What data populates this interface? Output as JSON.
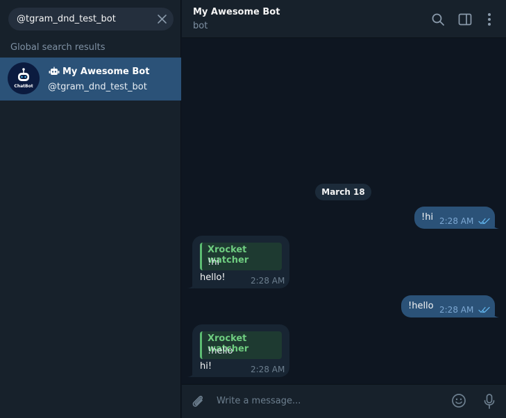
{
  "search": {
    "value": "@tgram_dnd_test_bot"
  },
  "sidebar": {
    "section_label": "Global search results",
    "results": [
      {
        "title": "My Awesome Bot",
        "username": "@tgram_dnd_test_bot",
        "avatar_text": "ChatBot"
      }
    ]
  },
  "chat": {
    "title": "My Awesome Bot",
    "status": "bot",
    "date_separator": "March 18",
    "messages": [
      {
        "direction": "out",
        "text": "!hi",
        "time": "2:28 AM",
        "read": true
      },
      {
        "direction": "in",
        "reply_to": {
          "name": "Xrocket watcher",
          "text": "!hi"
        },
        "text": "hello!",
        "time": "2:28 AM"
      },
      {
        "direction": "out",
        "text": "!hello",
        "time": "2:28 AM",
        "read": true
      },
      {
        "direction": "in",
        "reply_to": {
          "name": "Xrocket watcher",
          "text": "!hello"
        },
        "text": "hi!",
        "time": "2:28 AM"
      }
    ]
  },
  "composer": {
    "placeholder": "Write a message..."
  },
  "icons": {
    "search_clear": "close-icon",
    "bot_badge": "bot-icon",
    "header": [
      "search-icon",
      "sidebar-toggle-icon",
      "more-vertical-icon"
    ],
    "composer": [
      "paperclip-icon",
      "emoji-icon",
      "microphone-icon"
    ],
    "read_receipt": "double-check-icon"
  },
  "colors": {
    "app_background": "#0e1621",
    "panel": "#17212b",
    "selected_row": "#2b5278",
    "outgoing_bubble": "#2b5278",
    "incoming_bubble": "#182533",
    "reply_accent": "#5cbc72",
    "secondary_text": "#7f91a4"
  }
}
